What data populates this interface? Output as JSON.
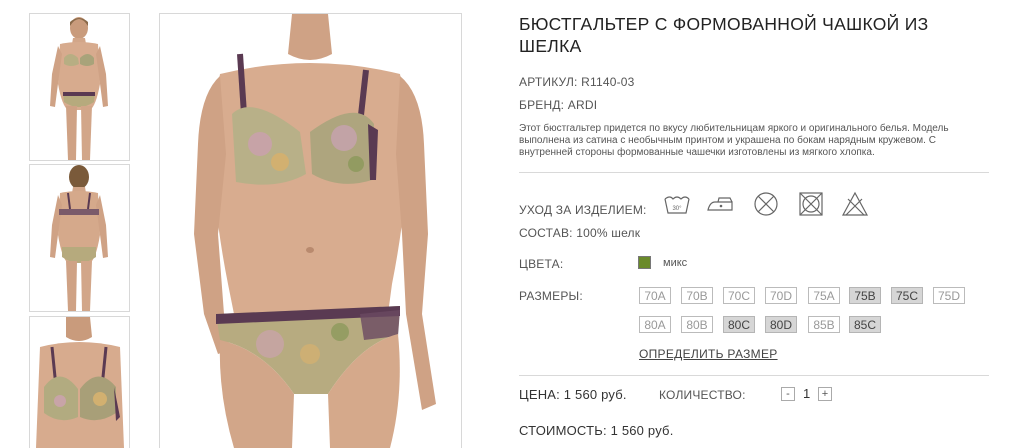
{
  "product": {
    "title": "БЮСТГАЛЬТЕР С ФОРМОВАННОЙ ЧАШКОЙ ИЗ ШЕЛКА",
    "article_label": "АРТИКУЛ:",
    "article": "R1140-03",
    "brand_label": "БРЕНД:",
    "brand": "ARDI",
    "description": "Этот бюстгальтер придется по вкусу любительницам яркого и оригинального белья. Модель выполнена из сатина с необычным принтом и украшена по бокам нарядным кружевом. С внутренней стороны формованные чашечки изготовлены из мягкого хлопка.",
    "care_label": "УХОД ЗА ИЗДЕЛИЕМ:",
    "care_icons": [
      "wash-30-icon",
      "iron-low-icon",
      "no-tumble-dry-icon",
      "no-dryer-icon",
      "no-bleach-icon"
    ],
    "composition_label": "СОСТАВ:",
    "composition": "100% шелк",
    "colors_label": "ЦВЕТА:",
    "color_name": "микс",
    "color_hex": "#6a8a2a",
    "sizes_label": "РАЗМЕРЫ:",
    "sizes": [
      {
        "label": "70A",
        "available": false
      },
      {
        "label": "70B",
        "available": false
      },
      {
        "label": "70C",
        "available": false
      },
      {
        "label": "70D",
        "available": false
      },
      {
        "label": "75A",
        "available": false
      },
      {
        "label": "75B",
        "available": true
      },
      {
        "label": "75C",
        "available": true
      },
      {
        "label": "75D",
        "available": false
      },
      {
        "label": "80A",
        "available": false
      },
      {
        "label": "80B",
        "available": false
      },
      {
        "label": "80C",
        "available": true
      },
      {
        "label": "80D",
        "available": true
      },
      {
        "label": "85B",
        "available": false
      },
      {
        "label": "85C",
        "available": true
      }
    ],
    "size_link": "ОПРЕДЕЛИТЬ РАЗМЕР",
    "price_label": "ЦЕНА:",
    "price": "1 560 руб.",
    "quantity_label": "КОЛИЧЕСТВО:",
    "quantity": "1",
    "minus": "-",
    "plus": "+",
    "total_label": "СТОИМОСТЬ:",
    "total": "1 560 руб."
  }
}
